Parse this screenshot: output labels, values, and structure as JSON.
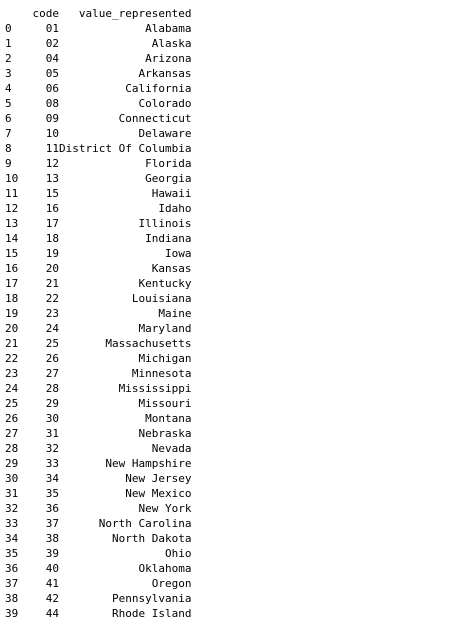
{
  "table": {
    "columns": [
      "code",
      "value_represented"
    ],
    "rows": [
      {
        "index": "0",
        "code": "01",
        "value": "Alabama"
      },
      {
        "index": "1",
        "code": "02",
        "value": "Alaska"
      },
      {
        "index": "2",
        "code": "04",
        "value": "Arizona"
      },
      {
        "index": "3",
        "code": "05",
        "value": "Arkansas"
      },
      {
        "index": "4",
        "code": "06",
        "value": "California"
      },
      {
        "index": "5",
        "code": "08",
        "value": "Colorado"
      },
      {
        "index": "6",
        "code": "09",
        "value": "Connecticut"
      },
      {
        "index": "7",
        "code": "10",
        "value": "Delaware"
      },
      {
        "index": "8",
        "code": "11",
        "value": "District Of Columbia"
      },
      {
        "index": "9",
        "code": "12",
        "value": "Florida"
      },
      {
        "index": "10",
        "code": "13",
        "value": "Georgia"
      },
      {
        "index": "11",
        "code": "15",
        "value": "Hawaii"
      },
      {
        "index": "12",
        "code": "16",
        "value": "Idaho"
      },
      {
        "index": "13",
        "code": "17",
        "value": "Illinois"
      },
      {
        "index": "14",
        "code": "18",
        "value": "Indiana"
      },
      {
        "index": "15",
        "code": "19",
        "value": "Iowa"
      },
      {
        "index": "16",
        "code": "20",
        "value": "Kansas"
      },
      {
        "index": "17",
        "code": "21",
        "value": "Kentucky"
      },
      {
        "index": "18",
        "code": "22",
        "value": "Louisiana"
      },
      {
        "index": "19",
        "code": "23",
        "value": "Maine"
      },
      {
        "index": "20",
        "code": "24",
        "value": "Maryland"
      },
      {
        "index": "21",
        "code": "25",
        "value": "Massachusetts"
      },
      {
        "index": "22",
        "code": "26",
        "value": "Michigan"
      },
      {
        "index": "23",
        "code": "27",
        "value": "Minnesota"
      },
      {
        "index": "24",
        "code": "28",
        "value": "Mississippi"
      },
      {
        "index": "25",
        "code": "29",
        "value": "Missouri"
      },
      {
        "index": "26",
        "code": "30",
        "value": "Montana"
      },
      {
        "index": "27",
        "code": "31",
        "value": "Nebraska"
      },
      {
        "index": "28",
        "code": "32",
        "value": "Nevada"
      },
      {
        "index": "29",
        "code": "33",
        "value": "New Hampshire"
      },
      {
        "index": "30",
        "code": "34",
        "value": "New Jersey"
      },
      {
        "index": "31",
        "code": "35",
        "value": "New Mexico"
      },
      {
        "index": "32",
        "code": "36",
        "value": "New York"
      },
      {
        "index": "33",
        "code": "37",
        "value": "North Carolina"
      },
      {
        "index": "34",
        "code": "38",
        "value": "North Dakota"
      },
      {
        "index": "35",
        "code": "39",
        "value": "Ohio"
      },
      {
        "index": "36",
        "code": "40",
        "value": "Oklahoma"
      },
      {
        "index": "37",
        "code": "41",
        "value": "Oregon"
      },
      {
        "index": "38",
        "code": "42",
        "value": "Pennsylvania"
      },
      {
        "index": "39",
        "code": "44",
        "value": "Rhode Island"
      }
    ]
  }
}
